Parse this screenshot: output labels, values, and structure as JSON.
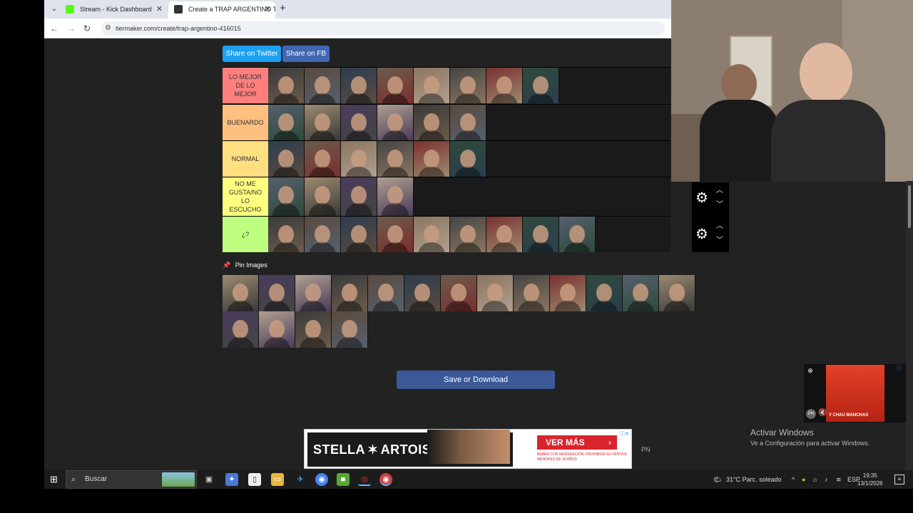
{
  "browser": {
    "tabs": [
      {
        "title": "Stream - Kick Dashboard",
        "favicon_color": "#53fc18"
      },
      {
        "title": "Create a TRAP ARGENTINO Tie",
        "favicon_color": "#333333"
      }
    ],
    "url": "tiermaker.com/create/trap-argentino-416015"
  },
  "share": {
    "twitter": "Share on Twitter",
    "facebook": "Share on FB"
  },
  "tiers": [
    {
      "label": "LO MEJOR DE LO MEJOR",
      "color": "#ff7f7f",
      "images": 8
    },
    {
      "label": "BUENARDO",
      "color": "#ffbf7f",
      "images": 6
    },
    {
      "label": "NORMAL",
      "color": "#ffdf7f",
      "images": 6
    },
    {
      "label": "NO ME GUSTA/NO LO ESCUCHO",
      "color": "#ffff7f",
      "images": 4
    },
    {
      "label": "¿?",
      "color": "#bfff7f",
      "images": 9
    }
  ],
  "pool": {
    "title": "Pin Images",
    "images": 17
  },
  "save_button": "Save or Download",
  "ads": {
    "bottom": {
      "brand": "STELLA",
      "brand2": "ARTOIS",
      "cta": "VER MÁS",
      "legal": "BEBER CON MODERACIÓN. PROHIBIDA SU VENTA A MENORES DE 18 AÑOS"
    },
    "side": {
      "text": "Y CHAU MANCHAS"
    },
    "pn": "PN"
  },
  "windows_activation": {
    "title": "Activar Windows",
    "subtitle": "Ve a Configuración para activar Windows."
  },
  "taskbar": {
    "search": "Buscar",
    "weather": "31°C  Parc. soleado",
    "lang": "ESP",
    "time": "19:35",
    "date": "13/1/2026"
  }
}
